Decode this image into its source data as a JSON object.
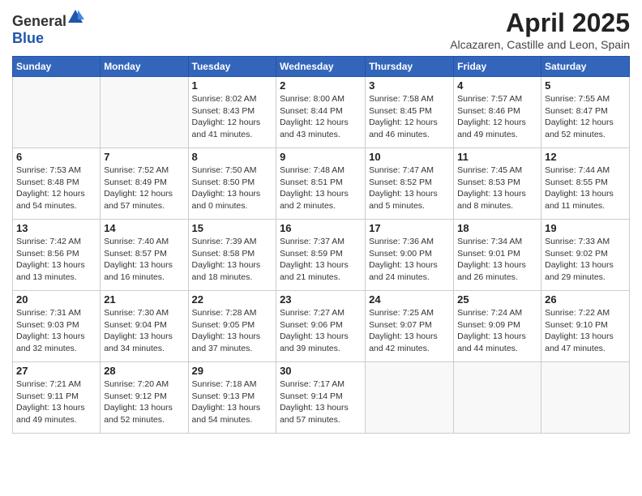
{
  "header": {
    "logo_general": "General",
    "logo_blue": "Blue",
    "title": "April 2025",
    "subtitle": "Alcazaren, Castille and Leon, Spain"
  },
  "weekdays": [
    "Sunday",
    "Monday",
    "Tuesday",
    "Wednesday",
    "Thursday",
    "Friday",
    "Saturday"
  ],
  "weeks": [
    [
      {
        "day": "",
        "sunrise": "",
        "sunset": "",
        "daylight": ""
      },
      {
        "day": "",
        "sunrise": "",
        "sunset": "",
        "daylight": ""
      },
      {
        "day": "1",
        "sunrise": "Sunrise: 8:02 AM",
        "sunset": "Sunset: 8:43 PM",
        "daylight": "Daylight: 12 hours and 41 minutes."
      },
      {
        "day": "2",
        "sunrise": "Sunrise: 8:00 AM",
        "sunset": "Sunset: 8:44 PM",
        "daylight": "Daylight: 12 hours and 43 minutes."
      },
      {
        "day": "3",
        "sunrise": "Sunrise: 7:58 AM",
        "sunset": "Sunset: 8:45 PM",
        "daylight": "Daylight: 12 hours and 46 minutes."
      },
      {
        "day": "4",
        "sunrise": "Sunrise: 7:57 AM",
        "sunset": "Sunset: 8:46 PM",
        "daylight": "Daylight: 12 hours and 49 minutes."
      },
      {
        "day": "5",
        "sunrise": "Sunrise: 7:55 AM",
        "sunset": "Sunset: 8:47 PM",
        "daylight": "Daylight: 12 hours and 52 minutes."
      }
    ],
    [
      {
        "day": "6",
        "sunrise": "Sunrise: 7:53 AM",
        "sunset": "Sunset: 8:48 PM",
        "daylight": "Daylight: 12 hours and 54 minutes."
      },
      {
        "day": "7",
        "sunrise": "Sunrise: 7:52 AM",
        "sunset": "Sunset: 8:49 PM",
        "daylight": "Daylight: 12 hours and 57 minutes."
      },
      {
        "day": "8",
        "sunrise": "Sunrise: 7:50 AM",
        "sunset": "Sunset: 8:50 PM",
        "daylight": "Daylight: 13 hours and 0 minutes."
      },
      {
        "day": "9",
        "sunrise": "Sunrise: 7:48 AM",
        "sunset": "Sunset: 8:51 PM",
        "daylight": "Daylight: 13 hours and 2 minutes."
      },
      {
        "day": "10",
        "sunrise": "Sunrise: 7:47 AM",
        "sunset": "Sunset: 8:52 PM",
        "daylight": "Daylight: 13 hours and 5 minutes."
      },
      {
        "day": "11",
        "sunrise": "Sunrise: 7:45 AM",
        "sunset": "Sunset: 8:53 PM",
        "daylight": "Daylight: 13 hours and 8 minutes."
      },
      {
        "day": "12",
        "sunrise": "Sunrise: 7:44 AM",
        "sunset": "Sunset: 8:55 PM",
        "daylight": "Daylight: 13 hours and 11 minutes."
      }
    ],
    [
      {
        "day": "13",
        "sunrise": "Sunrise: 7:42 AM",
        "sunset": "Sunset: 8:56 PM",
        "daylight": "Daylight: 13 hours and 13 minutes."
      },
      {
        "day": "14",
        "sunrise": "Sunrise: 7:40 AM",
        "sunset": "Sunset: 8:57 PM",
        "daylight": "Daylight: 13 hours and 16 minutes."
      },
      {
        "day": "15",
        "sunrise": "Sunrise: 7:39 AM",
        "sunset": "Sunset: 8:58 PM",
        "daylight": "Daylight: 13 hours and 18 minutes."
      },
      {
        "day": "16",
        "sunrise": "Sunrise: 7:37 AM",
        "sunset": "Sunset: 8:59 PM",
        "daylight": "Daylight: 13 hours and 21 minutes."
      },
      {
        "day": "17",
        "sunrise": "Sunrise: 7:36 AM",
        "sunset": "Sunset: 9:00 PM",
        "daylight": "Daylight: 13 hours and 24 minutes."
      },
      {
        "day": "18",
        "sunrise": "Sunrise: 7:34 AM",
        "sunset": "Sunset: 9:01 PM",
        "daylight": "Daylight: 13 hours and 26 minutes."
      },
      {
        "day": "19",
        "sunrise": "Sunrise: 7:33 AM",
        "sunset": "Sunset: 9:02 PM",
        "daylight": "Daylight: 13 hours and 29 minutes."
      }
    ],
    [
      {
        "day": "20",
        "sunrise": "Sunrise: 7:31 AM",
        "sunset": "Sunset: 9:03 PM",
        "daylight": "Daylight: 13 hours and 32 minutes."
      },
      {
        "day": "21",
        "sunrise": "Sunrise: 7:30 AM",
        "sunset": "Sunset: 9:04 PM",
        "daylight": "Daylight: 13 hours and 34 minutes."
      },
      {
        "day": "22",
        "sunrise": "Sunrise: 7:28 AM",
        "sunset": "Sunset: 9:05 PM",
        "daylight": "Daylight: 13 hours and 37 minutes."
      },
      {
        "day": "23",
        "sunrise": "Sunrise: 7:27 AM",
        "sunset": "Sunset: 9:06 PM",
        "daylight": "Daylight: 13 hours and 39 minutes."
      },
      {
        "day": "24",
        "sunrise": "Sunrise: 7:25 AM",
        "sunset": "Sunset: 9:07 PM",
        "daylight": "Daylight: 13 hours and 42 minutes."
      },
      {
        "day": "25",
        "sunrise": "Sunrise: 7:24 AM",
        "sunset": "Sunset: 9:09 PM",
        "daylight": "Daylight: 13 hours and 44 minutes."
      },
      {
        "day": "26",
        "sunrise": "Sunrise: 7:22 AM",
        "sunset": "Sunset: 9:10 PM",
        "daylight": "Daylight: 13 hours and 47 minutes."
      }
    ],
    [
      {
        "day": "27",
        "sunrise": "Sunrise: 7:21 AM",
        "sunset": "Sunset: 9:11 PM",
        "daylight": "Daylight: 13 hours and 49 minutes."
      },
      {
        "day": "28",
        "sunrise": "Sunrise: 7:20 AM",
        "sunset": "Sunset: 9:12 PM",
        "daylight": "Daylight: 13 hours and 52 minutes."
      },
      {
        "day": "29",
        "sunrise": "Sunrise: 7:18 AM",
        "sunset": "Sunset: 9:13 PM",
        "daylight": "Daylight: 13 hours and 54 minutes."
      },
      {
        "day": "30",
        "sunrise": "Sunrise: 7:17 AM",
        "sunset": "Sunset: 9:14 PM",
        "daylight": "Daylight: 13 hours and 57 minutes."
      },
      {
        "day": "",
        "sunrise": "",
        "sunset": "",
        "daylight": ""
      },
      {
        "day": "",
        "sunrise": "",
        "sunset": "",
        "daylight": ""
      },
      {
        "day": "",
        "sunrise": "",
        "sunset": "",
        "daylight": ""
      }
    ]
  ]
}
